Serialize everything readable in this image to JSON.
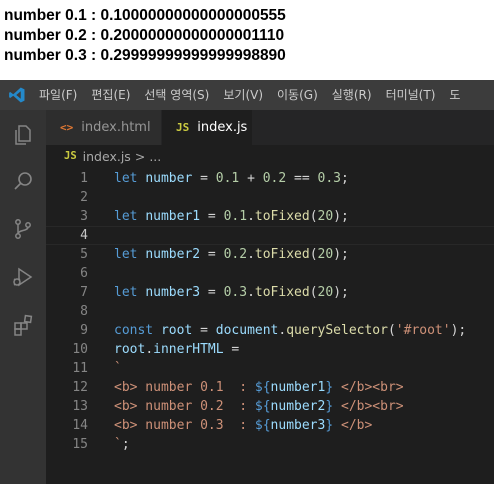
{
  "output": {
    "lines": [
      "number 0.1 : 0.10000000000000000555",
      "number 0.2 : 0.20000000000000001110",
      "number 0.3 : 0.29999999999999998890"
    ]
  },
  "menubar": {
    "items": [
      "파일(F)",
      "편집(E)",
      "선택 영역(S)",
      "보기(V)",
      "이동(G)",
      "실행(R)",
      "터미널(T)",
      "도"
    ]
  },
  "activity_icons": [
    "explorer-icon",
    "search-icon",
    "source-control-icon",
    "run-debug-icon",
    "extensions-icon"
  ],
  "tabs": [
    {
      "icon": "<>",
      "label": "index.html",
      "active": false
    },
    {
      "icon": "JS",
      "label": "index.js",
      "active": true
    }
  ],
  "breadcrumb": {
    "icon": "JS",
    "file": "index.js",
    "sep": ">",
    "rest": "..."
  },
  "editor": {
    "current_line": 4,
    "lines": [
      {
        "n": "1",
        "tokens": [
          [
            "kw",
            "let"
          ],
          [
            "op",
            " "
          ],
          [
            "var",
            "number"
          ],
          [
            "op",
            " = "
          ],
          [
            "num",
            "0.1"
          ],
          [
            "op",
            " + "
          ],
          [
            "num",
            "0.2"
          ],
          [
            "op",
            " == "
          ],
          [
            "num",
            "0.3"
          ],
          [
            "punc",
            ";"
          ]
        ]
      },
      {
        "n": "2",
        "tokens": []
      },
      {
        "n": "3",
        "tokens": [
          [
            "kw",
            "let"
          ],
          [
            "op",
            " "
          ],
          [
            "var",
            "number1"
          ],
          [
            "op",
            " = "
          ],
          [
            "num",
            "0.1"
          ],
          [
            "punc",
            "."
          ],
          [
            "fn",
            "toFixed"
          ],
          [
            "punc",
            "("
          ],
          [
            "num",
            "20"
          ],
          [
            "punc",
            ");"
          ]
        ]
      },
      {
        "n": "4",
        "tokens": []
      },
      {
        "n": "5",
        "tokens": [
          [
            "kw",
            "let"
          ],
          [
            "op",
            " "
          ],
          [
            "var",
            "number2"
          ],
          [
            "op",
            " = "
          ],
          [
            "num",
            "0.2"
          ],
          [
            "punc",
            "."
          ],
          [
            "fn",
            "toFixed"
          ],
          [
            "punc",
            "("
          ],
          [
            "num",
            "20"
          ],
          [
            "punc",
            ");"
          ]
        ]
      },
      {
        "n": "6",
        "tokens": []
      },
      {
        "n": "7",
        "tokens": [
          [
            "kw",
            "let"
          ],
          [
            "op",
            " "
          ],
          [
            "var",
            "number3"
          ],
          [
            "op",
            " = "
          ],
          [
            "num",
            "0.3"
          ],
          [
            "punc",
            "."
          ],
          [
            "fn",
            "toFixed"
          ],
          [
            "punc",
            "("
          ],
          [
            "num",
            "20"
          ],
          [
            "punc",
            ");"
          ]
        ]
      },
      {
        "n": "8",
        "tokens": []
      },
      {
        "n": "9",
        "tokens": [
          [
            "kw",
            "const"
          ],
          [
            "op",
            " "
          ],
          [
            "var",
            "root"
          ],
          [
            "op",
            " = "
          ],
          [
            "var",
            "document"
          ],
          [
            "punc",
            "."
          ],
          [
            "fn",
            "querySelector"
          ],
          [
            "punc",
            "("
          ],
          [
            "str",
            "'#root'"
          ],
          [
            "punc",
            ");"
          ]
        ]
      },
      {
        "n": "10",
        "tokens": [
          [
            "var",
            "root"
          ],
          [
            "punc",
            "."
          ],
          [
            "var",
            "innerHTML"
          ],
          [
            "op",
            " ="
          ]
        ]
      },
      {
        "n": "11",
        "tokens": [
          [
            "str",
            "`"
          ]
        ]
      },
      {
        "n": "12",
        "tokens": [
          [
            "str",
            "<b> number 0.1  : "
          ],
          [
            "kw",
            "${"
          ],
          [
            "var",
            "number1"
          ],
          [
            "kw",
            "}"
          ],
          [
            "str",
            " </b><br>"
          ]
        ]
      },
      {
        "n": "13",
        "tokens": [
          [
            "str",
            "<b> number 0.2  : "
          ],
          [
            "kw",
            "${"
          ],
          [
            "var",
            "number2"
          ],
          [
            "kw",
            "}"
          ],
          [
            "str",
            " </b><br>"
          ]
        ]
      },
      {
        "n": "14",
        "tokens": [
          [
            "str",
            "<b> number 0.3  : "
          ],
          [
            "kw",
            "${"
          ],
          [
            "var",
            "number3"
          ],
          [
            "kw",
            "}"
          ],
          [
            "str",
            " </b>"
          ]
        ]
      },
      {
        "n": "15",
        "tokens": [
          [
            "str",
            "`"
          ],
          [
            "punc",
            ";"
          ]
        ]
      }
    ]
  }
}
